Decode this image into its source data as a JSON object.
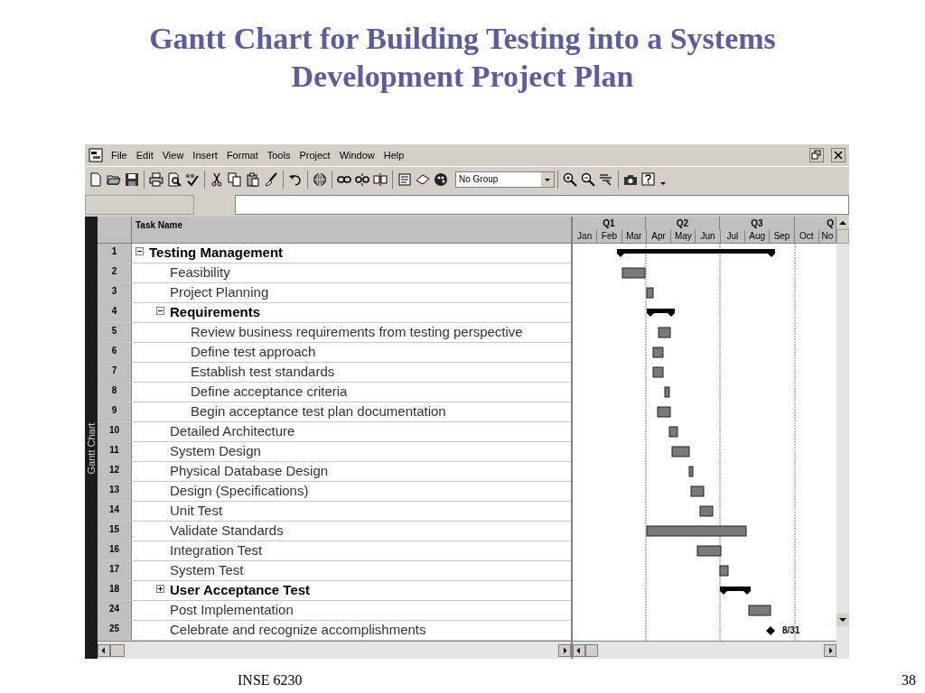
{
  "slide": {
    "title": "Gantt Chart for Building Testing into a Systems Development Project Plan",
    "footer": "INSE 6230",
    "page_number": "38"
  },
  "menu_bar": [
    "File",
    "Edit",
    "View",
    "Insert",
    "Format",
    "Tools",
    "Project",
    "Window",
    "Help"
  ],
  "toolbar": {
    "group_dropdown": "No Group"
  },
  "view_bar": {
    "label": "Gantt Chart"
  },
  "table": {
    "columns": [
      "Task Name"
    ],
    "tasks": [
      {
        "id": "1",
        "name": "Testing Management",
        "kind": "summary",
        "expanded": true,
        "children": [
          {
            "id": "2",
            "name": "Feasibility",
            "kind": "task"
          },
          {
            "id": "3",
            "name": "Project Planning",
            "kind": "task"
          },
          {
            "id": "4",
            "name": "Requirements",
            "kind": "summary",
            "expanded": true,
            "children": [
              {
                "id": "5",
                "name": "Review business requirements from testing perspective",
                "kind": "task"
              },
              {
                "id": "6",
                "name": "Define test approach",
                "kind": "task"
              },
              {
                "id": "7",
                "name": "Establish test standards",
                "kind": "task"
              },
              {
                "id": "8",
                "name": "Define acceptance criteria",
                "kind": "task"
              },
              {
                "id": "9",
                "name": "Begin acceptance test plan documentation",
                "kind": "task"
              }
            ]
          },
          {
            "id": "10",
            "name": "Detailed Architecture",
            "kind": "task"
          },
          {
            "id": "11",
            "name": "System Design",
            "kind": "task"
          },
          {
            "id": "12",
            "name": "Physical Database Design",
            "kind": "task"
          },
          {
            "id": "13",
            "name": "Design (Specifications)",
            "kind": "task"
          },
          {
            "id": "14",
            "name": "Unit Test",
            "kind": "task"
          },
          {
            "id": "15",
            "name": "Validate Standards",
            "kind": "task"
          },
          {
            "id": "16",
            "name": "Integration Test",
            "kind": "task"
          },
          {
            "id": "17",
            "name": "System Test",
            "kind": "task"
          },
          {
            "id": "18",
            "name": "User Acceptance Test",
            "kind": "summary",
            "expanded": false
          },
          {
            "id": "24",
            "name": "Post Implementation",
            "kind": "task"
          },
          {
            "id": "25",
            "name": "Celebrate and recognize accomplishments",
            "kind": "milestone",
            "milestone_label": "8/31"
          }
        ]
      }
    ]
  },
  "timescale": {
    "quarters": [
      "Q1",
      "Q2",
      "Q3",
      "Q"
    ],
    "months": [
      "Jan",
      "Feb",
      "Mar",
      "Apr",
      "May",
      "Jun",
      "Jul",
      "Aug",
      "Sep",
      "Oct",
      "No"
    ]
  }
}
